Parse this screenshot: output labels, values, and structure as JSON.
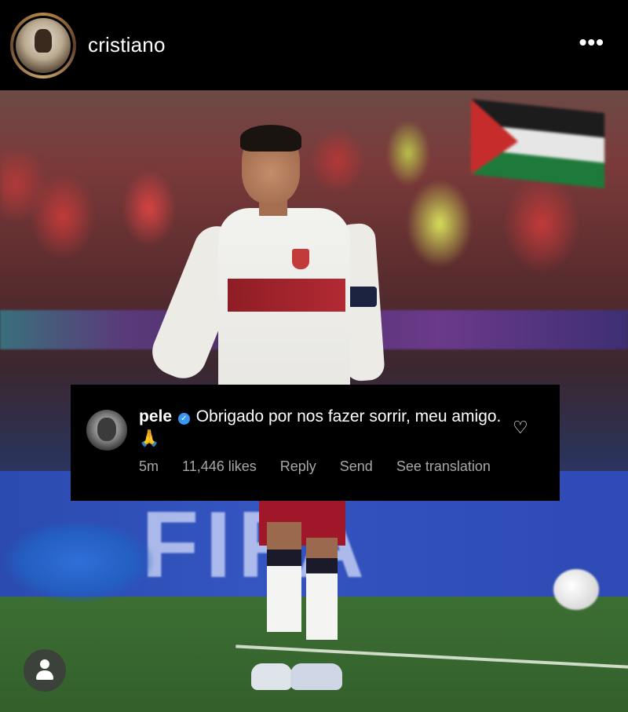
{
  "header": {
    "username": "cristiano",
    "more_icon": "more-horizontal-icon"
  },
  "comment": {
    "username": "pele",
    "verified": true,
    "text": "Obrigado por nos fazer sorrir, meu amigo.",
    "emoji": "🙏",
    "time": "5m",
    "likes": "11,446 likes",
    "reply_label": "Reply",
    "send_label": "Send",
    "translation_label": "See translation"
  },
  "photo": {
    "board_text": "FIFA"
  }
}
